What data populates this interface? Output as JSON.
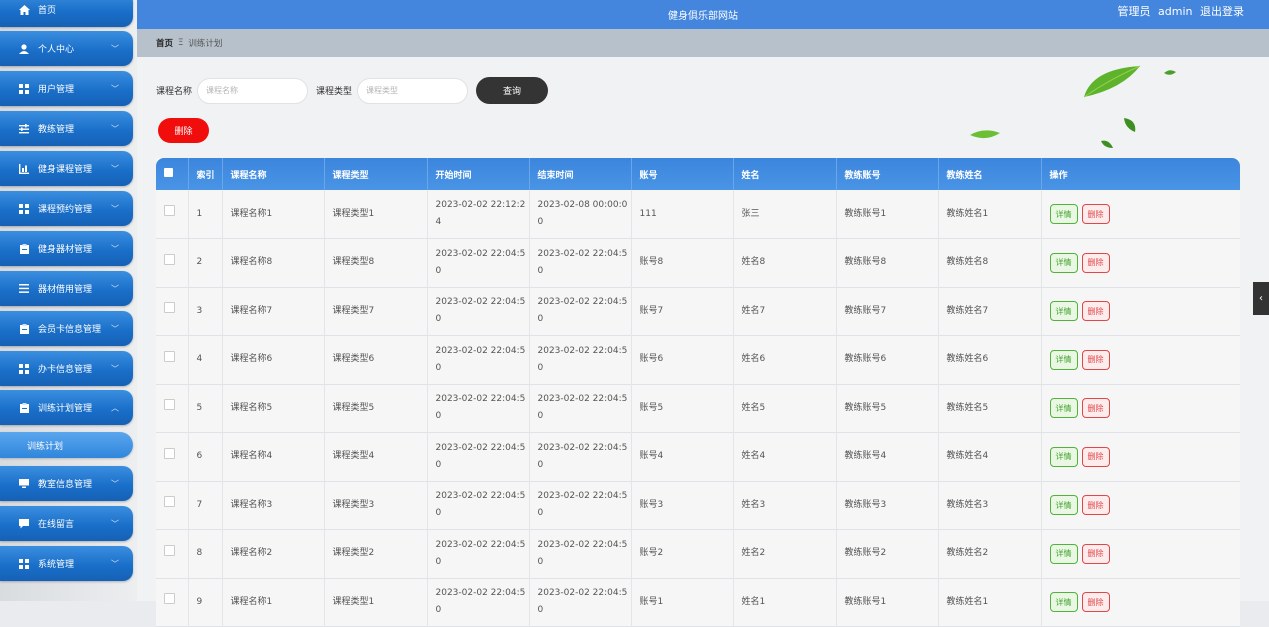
{
  "header": {
    "site_title": "健身俱乐部网站",
    "user_role": "管理员",
    "username": "admin",
    "logout": "退出登录"
  },
  "breadcrumb": {
    "home": "首页",
    "separator": "Ξ",
    "current": "训练计划"
  },
  "sidebar": {
    "items": [
      {
        "label": "首页",
        "icon": "home-icon"
      },
      {
        "label": "个人中心",
        "icon": "user-icon"
      },
      {
        "label": "用户管理",
        "icon": "grid-icon"
      },
      {
        "label": "教练管理",
        "icon": "sliders-icon"
      },
      {
        "label": "健身课程管理",
        "icon": "bar-chart-icon"
      },
      {
        "label": "课程预约管理",
        "icon": "grid-icon"
      },
      {
        "label": "健身器材管理",
        "icon": "clipboard-icon"
      },
      {
        "label": "器材借用管理",
        "icon": "list-icon"
      },
      {
        "label": "会员卡信息管理",
        "icon": "clipboard-icon"
      },
      {
        "label": "办卡信息管理",
        "icon": "grid-icon"
      },
      {
        "label": "训练计划管理",
        "icon": "clipboard-icon"
      },
      {
        "label": "教室信息管理",
        "icon": "monitor-icon"
      },
      {
        "label": "在线留言",
        "icon": "message-icon"
      },
      {
        "label": "系统管理",
        "icon": "grid-icon"
      }
    ],
    "sub_item": "训练计划"
  },
  "search": {
    "course_name_label": "课程名称",
    "course_name_placeholder": "课程名称",
    "course_type_label": "课程类型",
    "course_type_placeholder": "课程类型",
    "query_button": "查询",
    "delete_button": "删除"
  },
  "table": {
    "columns": [
      "索引",
      "课程名称",
      "课程类型",
      "开始时间",
      "结束时间",
      "账号",
      "姓名",
      "教练账号",
      "教练姓名",
      "操作"
    ],
    "detail_label": "详情",
    "delete_label": "删除",
    "rows": [
      {
        "index": "1",
        "course_name": "课程名称1",
        "course_type": "课程类型1",
        "start": "2023-02-02 22:12:24",
        "end": "2023-02-08 00:00:00",
        "account": "111",
        "name": "张三",
        "coach_account": "教练账号1",
        "coach_name": "教练姓名1"
      },
      {
        "index": "2",
        "course_name": "课程名称8",
        "course_type": "课程类型8",
        "start": "2023-02-02 22:04:50",
        "end": "2023-02-02 22:04:50",
        "account": "账号8",
        "name": "姓名8",
        "coach_account": "教练账号8",
        "coach_name": "教练姓名8"
      },
      {
        "index": "3",
        "course_name": "课程名称7",
        "course_type": "课程类型7",
        "start": "2023-02-02 22:04:50",
        "end": "2023-02-02 22:04:50",
        "account": "账号7",
        "name": "姓名7",
        "coach_account": "教练账号7",
        "coach_name": "教练姓名7"
      },
      {
        "index": "4",
        "course_name": "课程名称6",
        "course_type": "课程类型6",
        "start": "2023-02-02 22:04:50",
        "end": "2023-02-02 22:04:50",
        "account": "账号6",
        "name": "姓名6",
        "coach_account": "教练账号6",
        "coach_name": "教练姓名6"
      },
      {
        "index": "5",
        "course_name": "课程名称5",
        "course_type": "课程类型5",
        "start": "2023-02-02 22:04:50",
        "end": "2023-02-02 22:04:50",
        "account": "账号5",
        "name": "姓名5",
        "coach_account": "教练账号5",
        "coach_name": "教练姓名5"
      },
      {
        "index": "6",
        "course_name": "课程名称4",
        "course_type": "课程类型4",
        "start": "2023-02-02 22:04:50",
        "end": "2023-02-02 22:04:50",
        "account": "账号4",
        "name": "姓名4",
        "coach_account": "教练账号4",
        "coach_name": "教练姓名4"
      },
      {
        "index": "7",
        "course_name": "课程名称3",
        "course_type": "课程类型3",
        "start": "2023-02-02 22:04:50",
        "end": "2023-02-02 22:04:50",
        "account": "账号3",
        "name": "姓名3",
        "coach_account": "教练账号3",
        "coach_name": "教练姓名3"
      },
      {
        "index": "8",
        "course_name": "课程名称2",
        "course_type": "课程类型2",
        "start": "2023-02-02 22:04:50",
        "end": "2023-02-02 22:04:50",
        "account": "账号2",
        "name": "姓名2",
        "coach_account": "教练账号2",
        "coach_name": "教练姓名2"
      },
      {
        "index": "9",
        "course_name": "课程名称1",
        "course_type": "课程类型1",
        "start": "2023-02-02 22:04:50",
        "end": "2023-02-02 22:04:50",
        "account": "账号1",
        "name": "姓名1",
        "coach_account": "教练账号1",
        "coach_name": "教练姓名1"
      }
    ]
  },
  "colors": {
    "header_blue": "#4486de",
    "sidebar_blue": "#1a6fc9",
    "delete_red": "#f20d0d",
    "detail_green": "#52b33a"
  }
}
